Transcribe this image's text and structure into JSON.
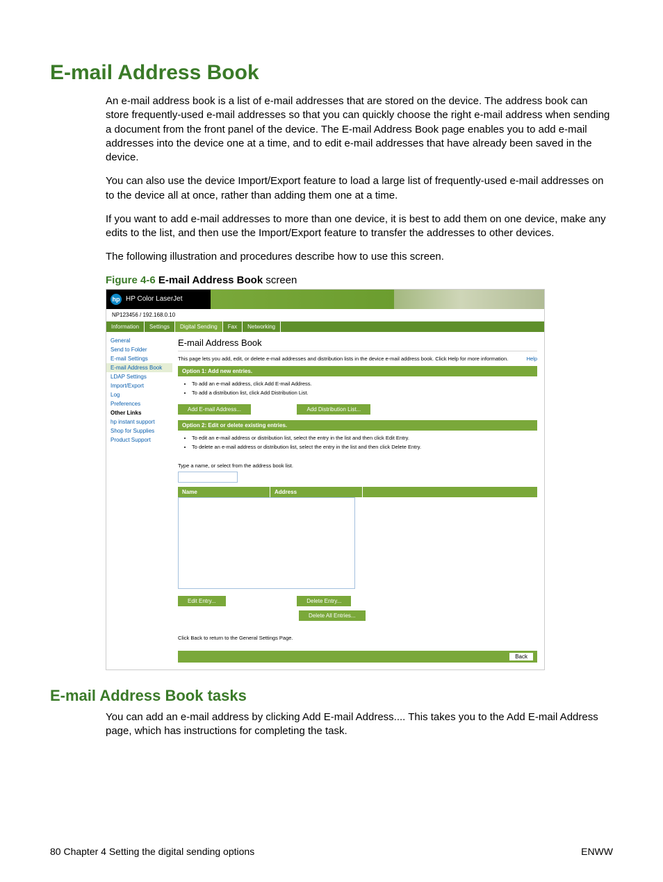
{
  "title": "E-mail Address Book",
  "paragraphs": {
    "p1": "An e-mail address book is a list of e-mail addresses that are stored on the device. The address book can store frequently-used e-mail addresses so that you can quickly choose the right e-mail address when sending a document from the front panel of the device. The E-mail Address Book page enables you to add e-mail addresses into the device one at a time, and to edit e-mail addresses that have already been saved in the device.",
    "p2": "You can also use the device Import/Export feature to load a large list of frequently-used e-mail addresses on to the device all at once, rather than adding them one at a time.",
    "p3": "If you want to add e-mail addresses to more than one device, it is best to add them on one device, make any edits to the list, and then use the Import/Export feature to transfer the addresses to other devices.",
    "p4": "The following illustration and procedures describe how to use this screen."
  },
  "figure": {
    "id": "Figure 4-6",
    "strong": "E-mail Address Book",
    "tail": " screen"
  },
  "tasks_title": "E-mail Address Book tasks",
  "tasks_p1": "You can add an e-mail address by clicking Add E-mail Address.... This takes you to the Add E-mail Address page, which has instructions for completing the task.",
  "footer": {
    "left": "80    Chapter 4   Setting the digital sending options",
    "right": "ENWW"
  },
  "screenshot": {
    "hp_label": "HP Color LaserJet",
    "device_line": "NP123456 / 192.168.0.10",
    "tabs": [
      "Information",
      "Settings",
      "Digital Sending",
      "Fax",
      "Networking"
    ],
    "active_tab_index": 2,
    "sidebar": {
      "items": [
        "General",
        "Send to Folder",
        "E-mail Settings",
        "E-mail Address Book",
        "LDAP Settings",
        "Import/Export",
        "Log",
        "Preferences"
      ],
      "other_links_label": "Other Links",
      "other_links": [
        "hp instant support",
        "Shop for Supplies",
        "Product Support"
      ],
      "active_index": 3
    },
    "panel": {
      "title": "E-mail Address Book",
      "desc": "This page lets you add, edit, or delete e-mail addresses and distribution lists in the device e-mail address book. Click Help for more information.",
      "help": "Help",
      "option1_header": "Option 1: Add new entries.",
      "opt1_b1": "To add an e-mail address, click Add E-mail Address.",
      "opt1_b2": "To add a distribution list, click Add Distribution List.",
      "btn_add_email": "Add E-mail Address...",
      "btn_add_list": "Add Distribution List...",
      "option2_header": "Option 2: Edit or delete existing entries.",
      "opt2_b1": "To edit an e-mail address or distribution list, select the entry in the list and then click Edit Entry.",
      "opt2_b2": "To delete an e-mail address or distribution list, select the entry in the list and then click Delete Entry.",
      "type_hint": "Type a name, or select from the address book list.",
      "col_name": "Name",
      "col_address": "Address",
      "btn_edit": "Edit Entry...",
      "btn_delete": "Delete Entry...",
      "btn_delete_all": "Delete All Entries...",
      "back_hint": "Click Back to return to the General Settings Page.",
      "btn_back": "Back"
    }
  }
}
